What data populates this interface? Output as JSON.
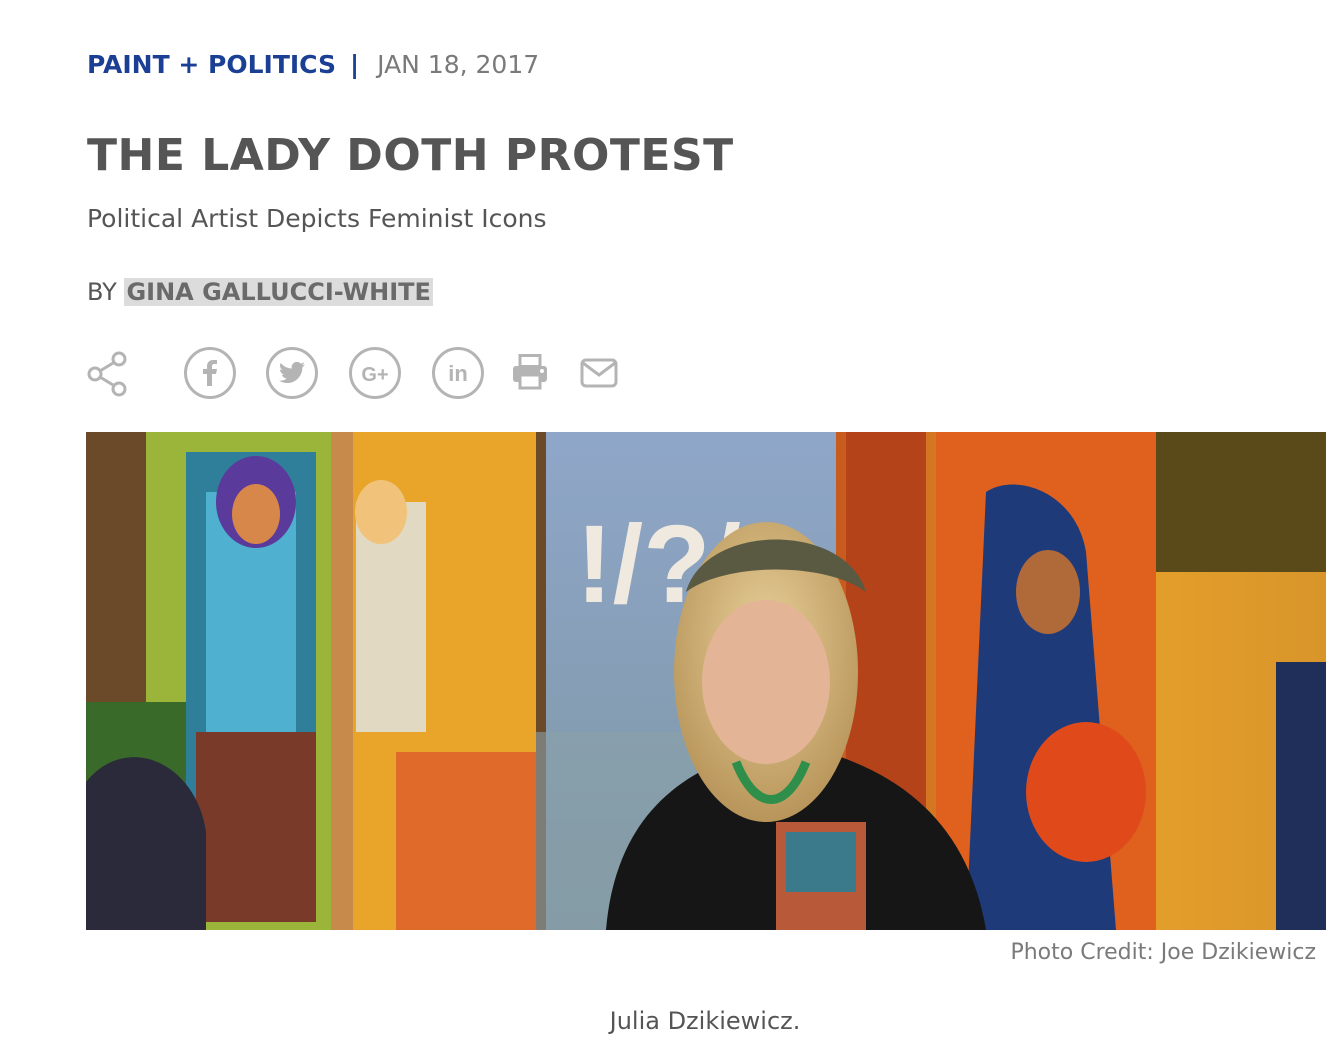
{
  "article": {
    "category": "PAINT + POLITICS",
    "separator": "|",
    "date": "JAN 18, 2017",
    "title": "THE LADY DOTH PROTEST",
    "subtitle": "Political Artist Depicts Feminist Icons",
    "byline_prefix": "BY",
    "author": "GINA GALLUCCI-WHITE"
  },
  "share": {
    "icons": [
      "share-icon",
      "facebook-icon",
      "twitter-icon",
      "google-plus-icon",
      "linkedin-icon",
      "print-icon",
      "email-icon"
    ],
    "google_plus_label": "G+",
    "linkedin_label": "in",
    "icon_color": "#b4b4b4"
  },
  "photo": {
    "credit": "Photo Credit: Joe Dzikiewicz",
    "caption": "Julia Dzikiewicz.",
    "painted_text": "!/?/"
  },
  "colors": {
    "category": "#1b3f94",
    "title": "#555555",
    "muted": "#7a7a7a",
    "author_highlight": "#dcdcdc"
  }
}
